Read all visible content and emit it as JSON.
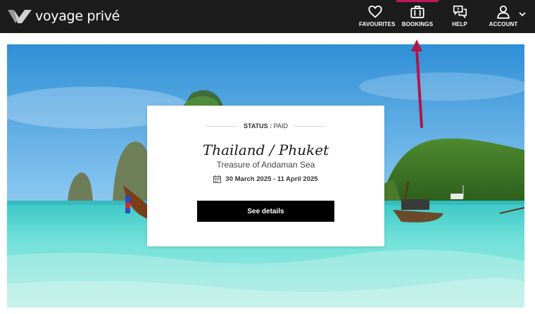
{
  "header": {
    "brand": "voyage privé",
    "nav": [
      {
        "label": "FAVOURITES",
        "icon": "heart-icon"
      },
      {
        "label": "BOOKINGS",
        "icon": "suitcase-icon",
        "active": true
      },
      {
        "label": "HELP",
        "icon": "help-chat-icon"
      },
      {
        "label": "ACCOUNT",
        "icon": "user-icon"
      }
    ],
    "accent_color": "#c2185b",
    "background": "#1c1c1c"
  },
  "booking": {
    "status_label": "STATUS :",
    "status_value": "PAID",
    "title": "Thailand / Phuket",
    "subtitle": "Treasure of Andaman Sea",
    "dates": "30 March 2025 - 11 April 2025",
    "details_button": "See details"
  },
  "annotation": {
    "arrow_color": "#b0164a"
  }
}
